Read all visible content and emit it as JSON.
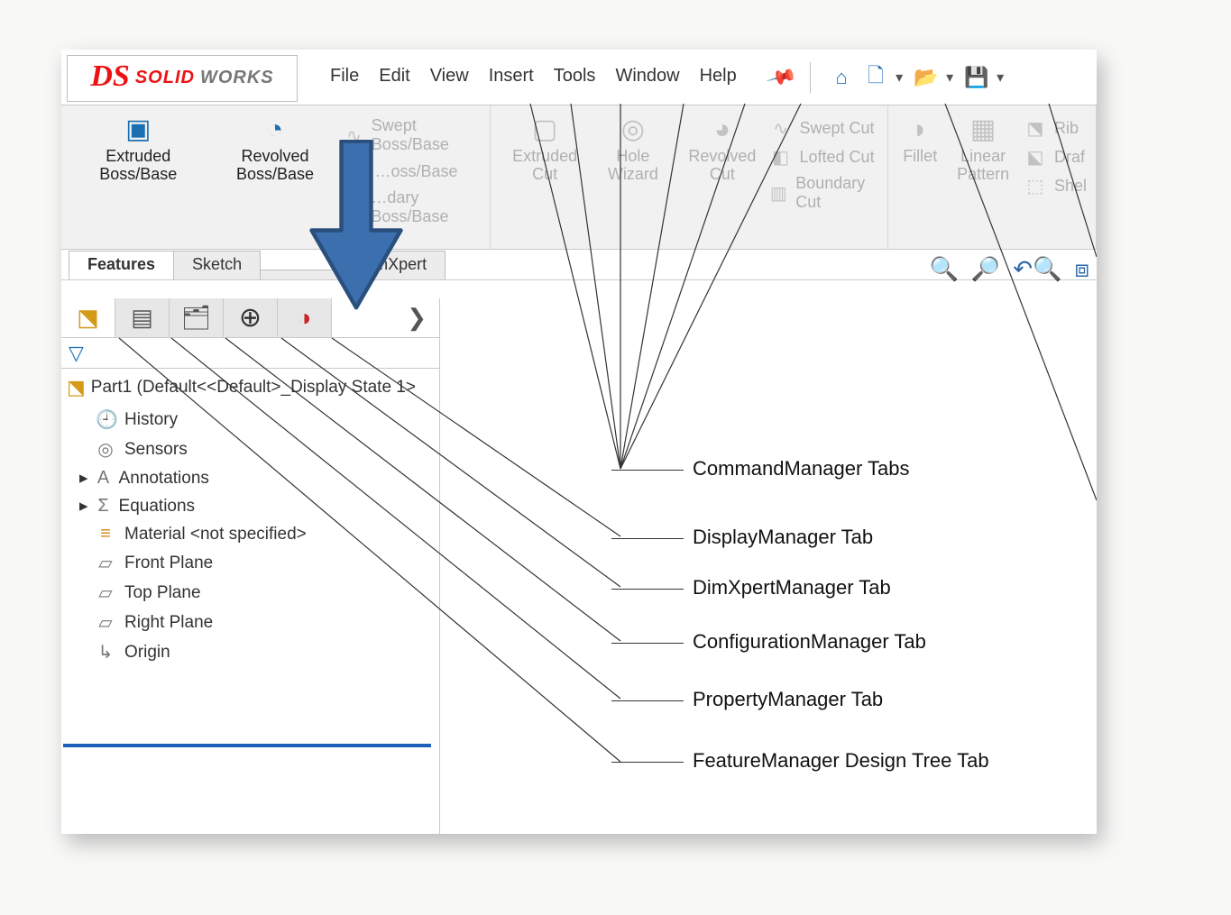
{
  "logo": {
    "ds": "DS",
    "solid": "SOLID",
    "works": "WORKS"
  },
  "menus": [
    "File",
    "Edit",
    "View",
    "Insert",
    "Tools",
    "Window",
    "Help"
  ],
  "ribbon": {
    "extruded_boss": "Extruded Boss/Base",
    "revolved_boss": "Revolved Boss/Base",
    "swept_boss": "Swept Boss/Base",
    "lofted_boss": "Lofted Boss/Base",
    "boundary_boss": "Boundary Boss/Base",
    "extruded_cut": "Extruded Cut",
    "hole_wizard": "Hole Wizard",
    "revolved_cut": "Revolved Cut",
    "swept_cut": "Swept Cut",
    "lofted_cut": "Lofted Cut",
    "boundary_cut": "Boundary Cut",
    "fillet": "Fillet",
    "linear_pattern": "Linear Pattern",
    "rib": "Rib",
    "draft": "Draft",
    "shell": "Shell"
  },
  "cmd_tabs": [
    "Features",
    "Sketch",
    "",
    "DimXpert"
  ],
  "tree": {
    "root": "Part1  (Default<<Default>_Display State 1>",
    "items": [
      {
        "label": "History"
      },
      {
        "label": "Sensors"
      },
      {
        "label": "Annotations",
        "exp": true
      },
      {
        "label": "Equations",
        "exp": true
      },
      {
        "label": "Material <not specified>"
      },
      {
        "label": "Front Plane"
      },
      {
        "label": "Top Plane"
      },
      {
        "label": "Right Plane"
      },
      {
        "label": "Origin"
      }
    ]
  },
  "annotations": {
    "a1": "CommandManager Tabs",
    "a2": "DisplayManager Tab",
    "a3": "DimXpertManager Tab",
    "a4": "ConfigurationManager Tab",
    "a5": "PropertyManager Tab",
    "a6": "FeatureManager Design Tree Tab"
  }
}
